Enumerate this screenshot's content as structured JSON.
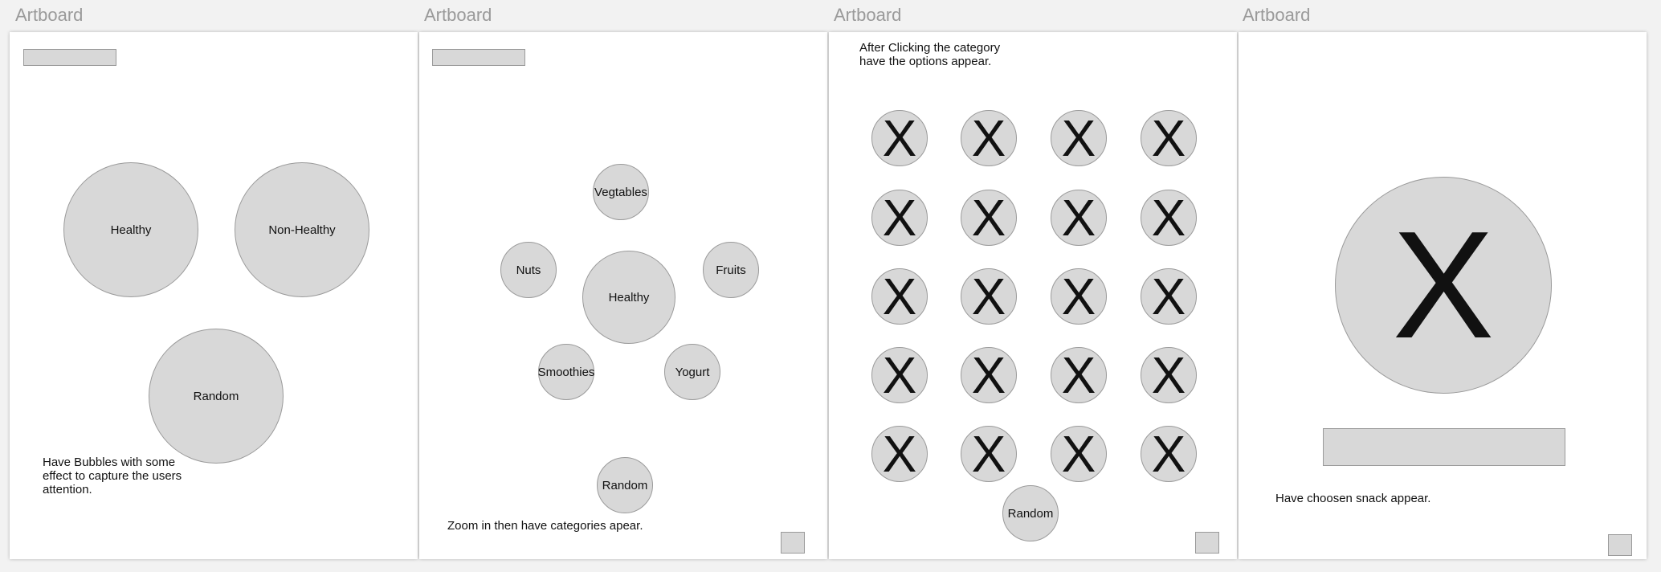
{
  "boards": [
    {
      "title": "Artboard",
      "bubbles": {
        "healthy": "Healthy",
        "non_healthy": "Non-Healthy",
        "random": "Random"
      },
      "note": "Have Bubbles with some\neffect to capture the users\nattention."
    },
    {
      "title": "Artboard",
      "bubbles": {
        "vegtables": "Vegtables",
        "nuts": "Nuts",
        "healthy": "Healthy",
        "fruits": "Fruits",
        "smoothies": "Smoothies",
        "yogurt": "Yogurt",
        "random": "Random"
      },
      "note": "Zoom in then have categories apear."
    },
    {
      "title": "Artboard",
      "note": "After Clicking the category\nhave the options appear.",
      "option_glyph": "X",
      "random": "Random"
    },
    {
      "title": "Artboard",
      "snack_glyph": "X",
      "note": "Have choosen snack appear."
    }
  ]
}
